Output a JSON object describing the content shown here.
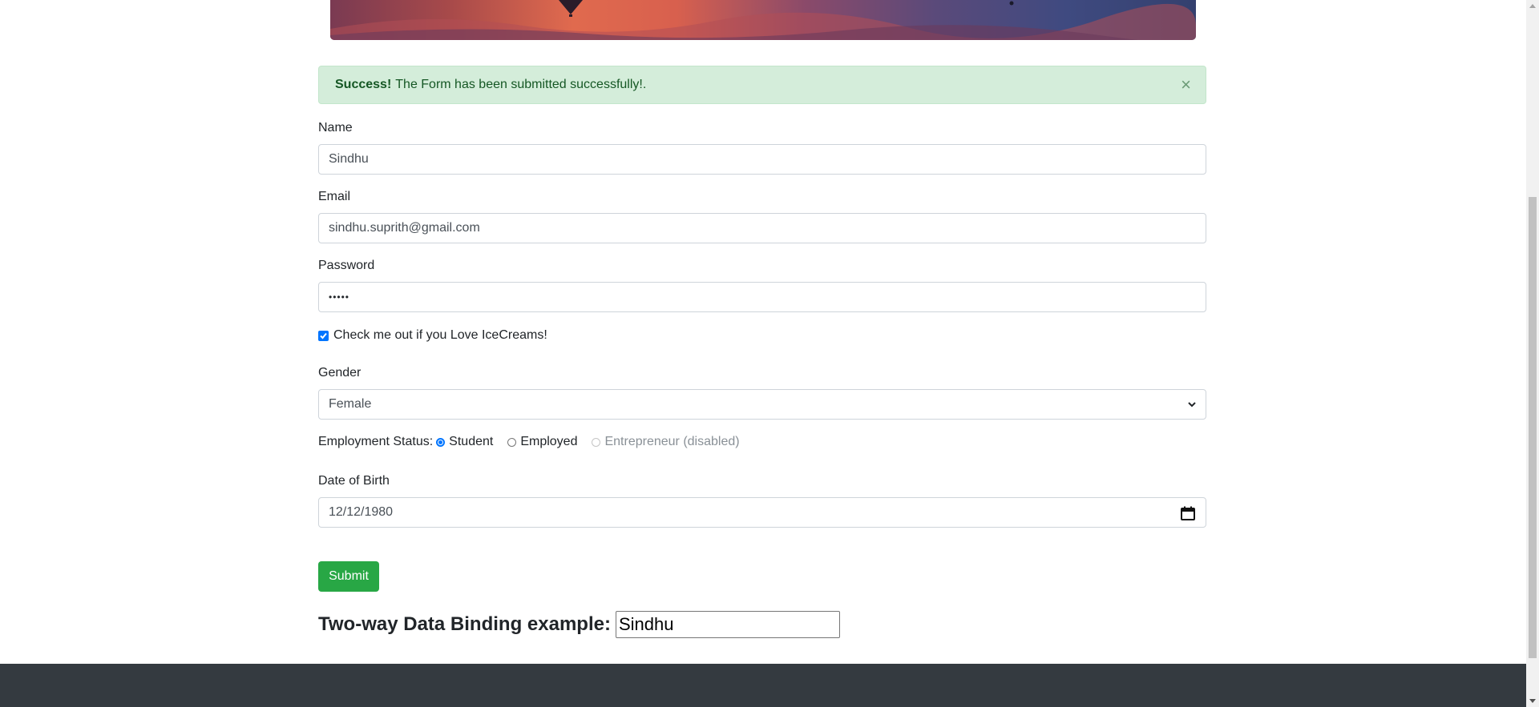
{
  "alert": {
    "strong": "Success!",
    "message": "The Form has been submitted successfully!.",
    "close": "×"
  },
  "form": {
    "name": {
      "label": "Name",
      "value": "Sindhu"
    },
    "email": {
      "label": "Email",
      "value": "sindhu.suprith@gmail.com"
    },
    "password": {
      "label": "Password",
      "value": "•••••"
    },
    "checkbox": {
      "label": "Check me out if you Love IceCreams!",
      "checked": true
    },
    "gender": {
      "label": "Gender",
      "value": "Female"
    },
    "employment": {
      "label": "Employment Status:",
      "options": [
        {
          "label": "Student",
          "checked": true
        },
        {
          "label": "Employed",
          "checked": false
        },
        {
          "label": "Entrepreneur (disabled)",
          "disabled": true
        }
      ]
    },
    "dob": {
      "label": "Date of Birth",
      "value": "12/12/1980"
    },
    "submit_label": "Submit"
  },
  "binding": {
    "title": "Two-way Data Binding example:",
    "value": "Sindhu"
  },
  "colors": {
    "success_bg": "#d4edda",
    "success_text": "#155724",
    "submit_bg": "#28a745",
    "footer_bg": "#343a40",
    "accent": "#0075ff"
  }
}
